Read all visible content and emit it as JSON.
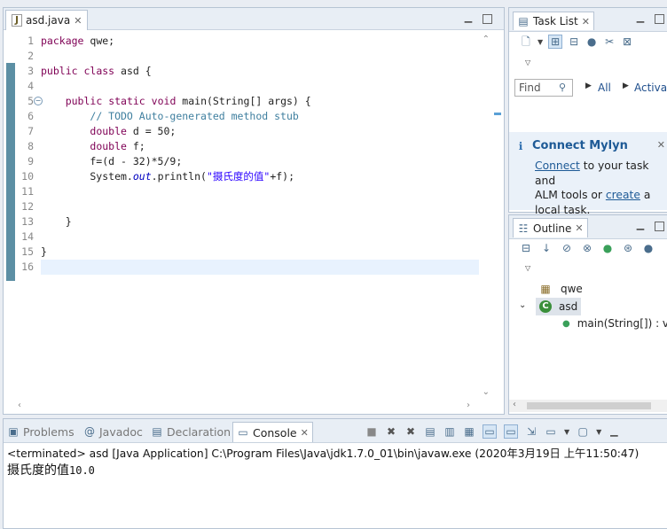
{
  "editor": {
    "tab_label": "asd.java",
    "lines": [
      {
        "n": "1",
        "html": "<span class=\"kw\">package</span> qwe;"
      },
      {
        "n": "2",
        "html": ""
      },
      {
        "n": "3",
        "html": "<span class=\"kw\">public</span> <span class=\"kw\">class</span> asd {"
      },
      {
        "n": "4",
        "html": ""
      },
      {
        "n": "5",
        "html": "    <span class=\"kw\">public</span> <span class=\"kw\">static</span> <span class=\"kw\">void</span> main(String[] args) {"
      },
      {
        "n": "6",
        "html": "        <span class=\"cm\">// TODO Auto-generated method stub</span>"
      },
      {
        "n": "7",
        "html": "        <span class=\"kw\">double</span> d = 50;"
      },
      {
        "n": "8",
        "html": "        <span class=\"kw\">double</span> f;"
      },
      {
        "n": "9",
        "html": "        f=(d - 32)*5/9;"
      },
      {
        "n": "10",
        "html": "        System.<span class=\"fld\">out</span>.println(<span class=\"str\">\"摄氏度的值\"</span>+f);"
      },
      {
        "n": "11",
        "html": ""
      },
      {
        "n": "12",
        "html": ""
      },
      {
        "n": "13",
        "html": "    }"
      },
      {
        "n": "14",
        "html": ""
      },
      {
        "n": "15",
        "html": "}"
      },
      {
        "n": "16",
        "html": ""
      }
    ]
  },
  "tasklist": {
    "tab_label": "Task List",
    "find_placeholder": "Find",
    "all_label": "All",
    "activate_label": "Activa..."
  },
  "mylyn": {
    "title": "Connect Mylyn",
    "connect_link": "Connect",
    "text1": " to your task and",
    "text2": "ALM tools or ",
    "create_link": "create",
    "text3": " a",
    "text4": "local task."
  },
  "outline": {
    "tab_label": "Outline",
    "package": "qwe",
    "class": "asd",
    "method": "main(String[]) : v"
  },
  "bottom": {
    "tabs": [
      "Problems",
      "Javadoc",
      "Declaration",
      "Console"
    ],
    "terminated": "<terminated> asd [Java Application] C:\\Program Files\\Java\\jdk1.7.0_01\\bin\\javaw.exe (2020年3月19日 上午11:50:47)",
    "output_label": "摄氏度的值",
    "output_value": "10.0"
  }
}
